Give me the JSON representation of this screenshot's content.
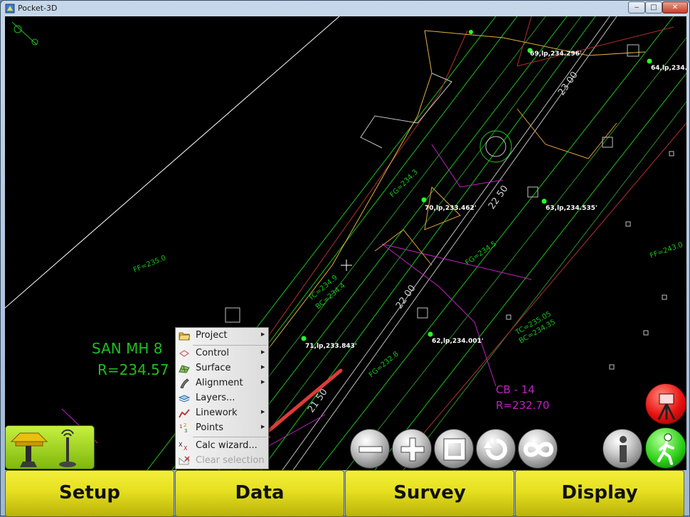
{
  "window": {
    "title": "Pocket-3D",
    "min_label": "‒",
    "max_label": "□",
    "close_label": "✕"
  },
  "drawing": {
    "point_labels": [
      "69,lp,234.296'",
      "64,lp,234.",
      "70,lp,233.462'",
      "63,lp,234.535'",
      "71,lp,233.843'",
      "62,lp,234.001'"
    ],
    "station_labels": [
      "23 00",
      "22 50",
      "22 00",
      "21 50"
    ],
    "manhole": {
      "name": "SAN MH 8",
      "rim": "R=234.57"
    },
    "catch_basin": {
      "name": "CB -  14",
      "rim": "R=232.70"
    },
    "fg_labels": [
      "FF=235.0",
      "FF=243.0",
      "FG=234.3",
      "FG=232.8",
      "FG=234.5"
    ],
    "tc_labels": [
      "TC=234.9",
      "BC=234.4",
      "TC=235.05",
      "BC=234.35"
    ]
  },
  "context_menu": {
    "items": [
      {
        "label": "Project",
        "icon": "folder-icon",
        "submenu": true,
        "enabled": true
      },
      {
        "label": "Control",
        "icon": "control-icon",
        "submenu": true,
        "enabled": true
      },
      {
        "label": "Surface",
        "icon": "surface-icon",
        "submenu": true,
        "enabled": true
      },
      {
        "label": "Alignment",
        "icon": "alignment-icon",
        "submenu": true,
        "enabled": true
      },
      {
        "label": "Layers...",
        "icon": "layers-icon",
        "submenu": false,
        "enabled": true
      },
      {
        "label": "Linework",
        "icon": "linework-icon",
        "submenu": true,
        "enabled": true
      },
      {
        "label": "Points",
        "icon": "points-icon",
        "submenu": true,
        "enabled": true
      },
      {
        "label": "Calc wizard...",
        "icon": "calc-wizard-icon",
        "submenu": false,
        "enabled": true
      },
      {
        "label": "Clear selection",
        "icon": "clear-selection-icon",
        "submenu": false,
        "enabled": false
      }
    ]
  },
  "nav": {
    "setup": "Setup",
    "data": "Data",
    "survey": "Survey",
    "display": "Display"
  },
  "tools": {
    "zoom_out": "zoom-out-icon",
    "zoom_in": "zoom-in-icon",
    "zoom_window": "zoom-window-icon",
    "rotate": "rotate-icon",
    "zoom_extents": "infinity-icon",
    "info": "info-icon",
    "walk": "walking-person-icon",
    "status": "tripod-icon"
  },
  "colors": {
    "cad_green": "#1fbf1f",
    "cad_magenta": "#c020c0",
    "button_yellow": "#e6e020",
    "arrow": "#e03a3a"
  }
}
